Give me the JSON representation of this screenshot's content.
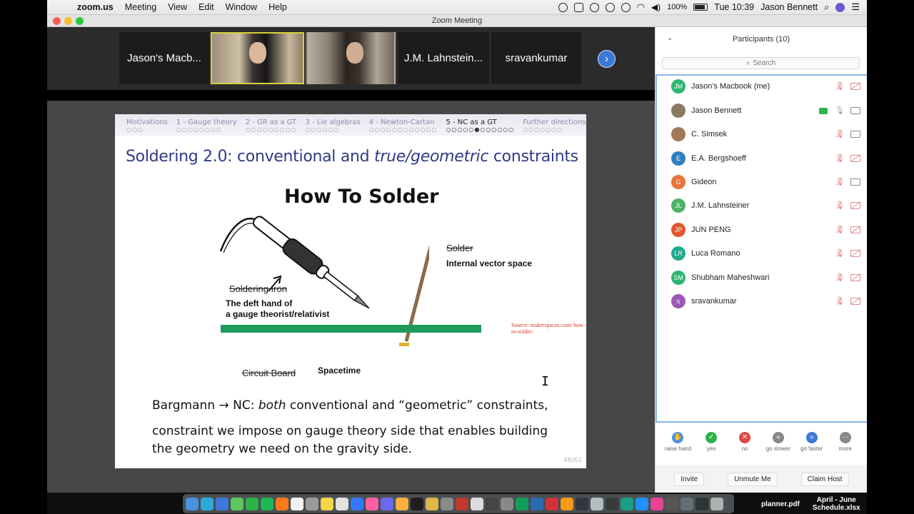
{
  "menubar": {
    "app": "zoom.us",
    "menus": [
      "Meeting",
      "View",
      "Edit",
      "Window",
      "Help"
    ],
    "battery": "100%",
    "time": "Tue 10:39",
    "user": "Jason Bennett"
  },
  "window": {
    "title": "Zoom Meeting"
  },
  "video_strip": {
    "tiles": [
      "Jason's Macb...",
      "J.M. Lahnstein...",
      "sravankumar"
    ]
  },
  "slide": {
    "nav": [
      {
        "label": "Motivations",
        "dots": "○○○"
      },
      {
        "label": "1 - Gauge theory",
        "dots": "○○○○○○○○"
      },
      {
        "label": "2 - GR as a GT",
        "dots": "○○○○○○○○○"
      },
      {
        "label": "3 - Lie algebras",
        "dots": "○○○○○○"
      },
      {
        "label": "4 - Newton-Cartan",
        "dots": "○○○○○○○○○○○○"
      },
      {
        "label": "5 - NC as a GT",
        "dots": "○○○○○●○○○○○○"
      },
      {
        "label": "Further directions",
        "dots": "○○○○○○○"
      }
    ],
    "title_a": "Soldering 2.0: conventional and ",
    "title_em": "true/geometric",
    "title_b": " constraints",
    "figure_title": "How To Solder",
    "labels": {
      "solder_strike": "Solder",
      "solder_new": "Internal vector space",
      "iron_strike": "Soldering Iron",
      "iron_new_1": "The deft hand of",
      "iron_new_2": "a gauge theorist/relativist",
      "board_strike": "Circuit Board",
      "board_new": "Spacetime",
      "source": "Source: makerspaces.com/ how-to-solder/"
    },
    "body_1a": "Bargmann → NC: ",
    "body_1em": "both",
    "body_1b": " conventional and “geometric” constraints,",
    "body_2": "constraint we impose on gauge theory side that enables building",
    "body_3": "the geometry we need on the gravity side.",
    "pager": "46/61"
  },
  "participants": {
    "title": "Participants (10)",
    "search_placeholder": "Search",
    "list": [
      {
        "initials": "JM",
        "name": "Jason's Macbook (me)",
        "color": "#2bb673",
        "mic": "muted",
        "video": "off"
      },
      {
        "initials": "",
        "name": "Jason Bennett",
        "color": "#8a7a62",
        "mic": "on",
        "video": "on",
        "sharing": true
      },
      {
        "initials": "",
        "name": "C. Simsek",
        "color": "#a0785a",
        "mic": "muted",
        "video": "on"
      },
      {
        "initials": "E",
        "name": "E.A. Bergshoeff",
        "color": "#2f7fbf",
        "mic": "muted",
        "video": "off"
      },
      {
        "initials": "G",
        "name": "Gideon",
        "color": "#e8743b",
        "mic": "muted",
        "video": "on"
      },
      {
        "initials": "JL",
        "name": "J.M. Lahnsteiner",
        "color": "#4db36a",
        "mic": "muted",
        "video": "off"
      },
      {
        "initials": "JP",
        "name": "JUN PENG",
        "color": "#e2572f",
        "mic": "muted",
        "video": "off"
      },
      {
        "initials": "LR",
        "name": "Luca Romano",
        "color": "#1fab8f",
        "mic": "muted",
        "video": "off"
      },
      {
        "initials": "SM",
        "name": "Shubham Maheshwari",
        "color": "#2bb673",
        "mic": "muted",
        "video": "off"
      },
      {
        "initials": "s",
        "name": "sravankumar",
        "color": "#9b59b6",
        "mic": "muted",
        "video": "off"
      }
    ],
    "reactions": [
      {
        "label": "raise hand",
        "icon": "hand-icon",
        "color": "#4a90e2",
        "glyph": "✋"
      },
      {
        "label": "yes",
        "icon": "check-icon",
        "color": "#2bb34a",
        "glyph": "✓"
      },
      {
        "label": "no",
        "icon": "x-icon",
        "color": "#e54646",
        "glyph": "✕"
      },
      {
        "label": "go slower",
        "icon": "rewind-icon",
        "color": "#888888",
        "glyph": "«"
      },
      {
        "label": "go faster",
        "icon": "fast-forward-icon",
        "color": "#3a79d8",
        "glyph": "»"
      },
      {
        "label": "more",
        "icon": "more-icon",
        "color": "#888888",
        "glyph": "···"
      }
    ],
    "footer": {
      "invite": "Invite",
      "unmute": "Unmute Me",
      "claim": "Claim Host"
    }
  },
  "dock": {
    "file1": "planner.pdf",
    "file2_line1": "April - June",
    "file2_line2": "Schedule.xlsx"
  }
}
